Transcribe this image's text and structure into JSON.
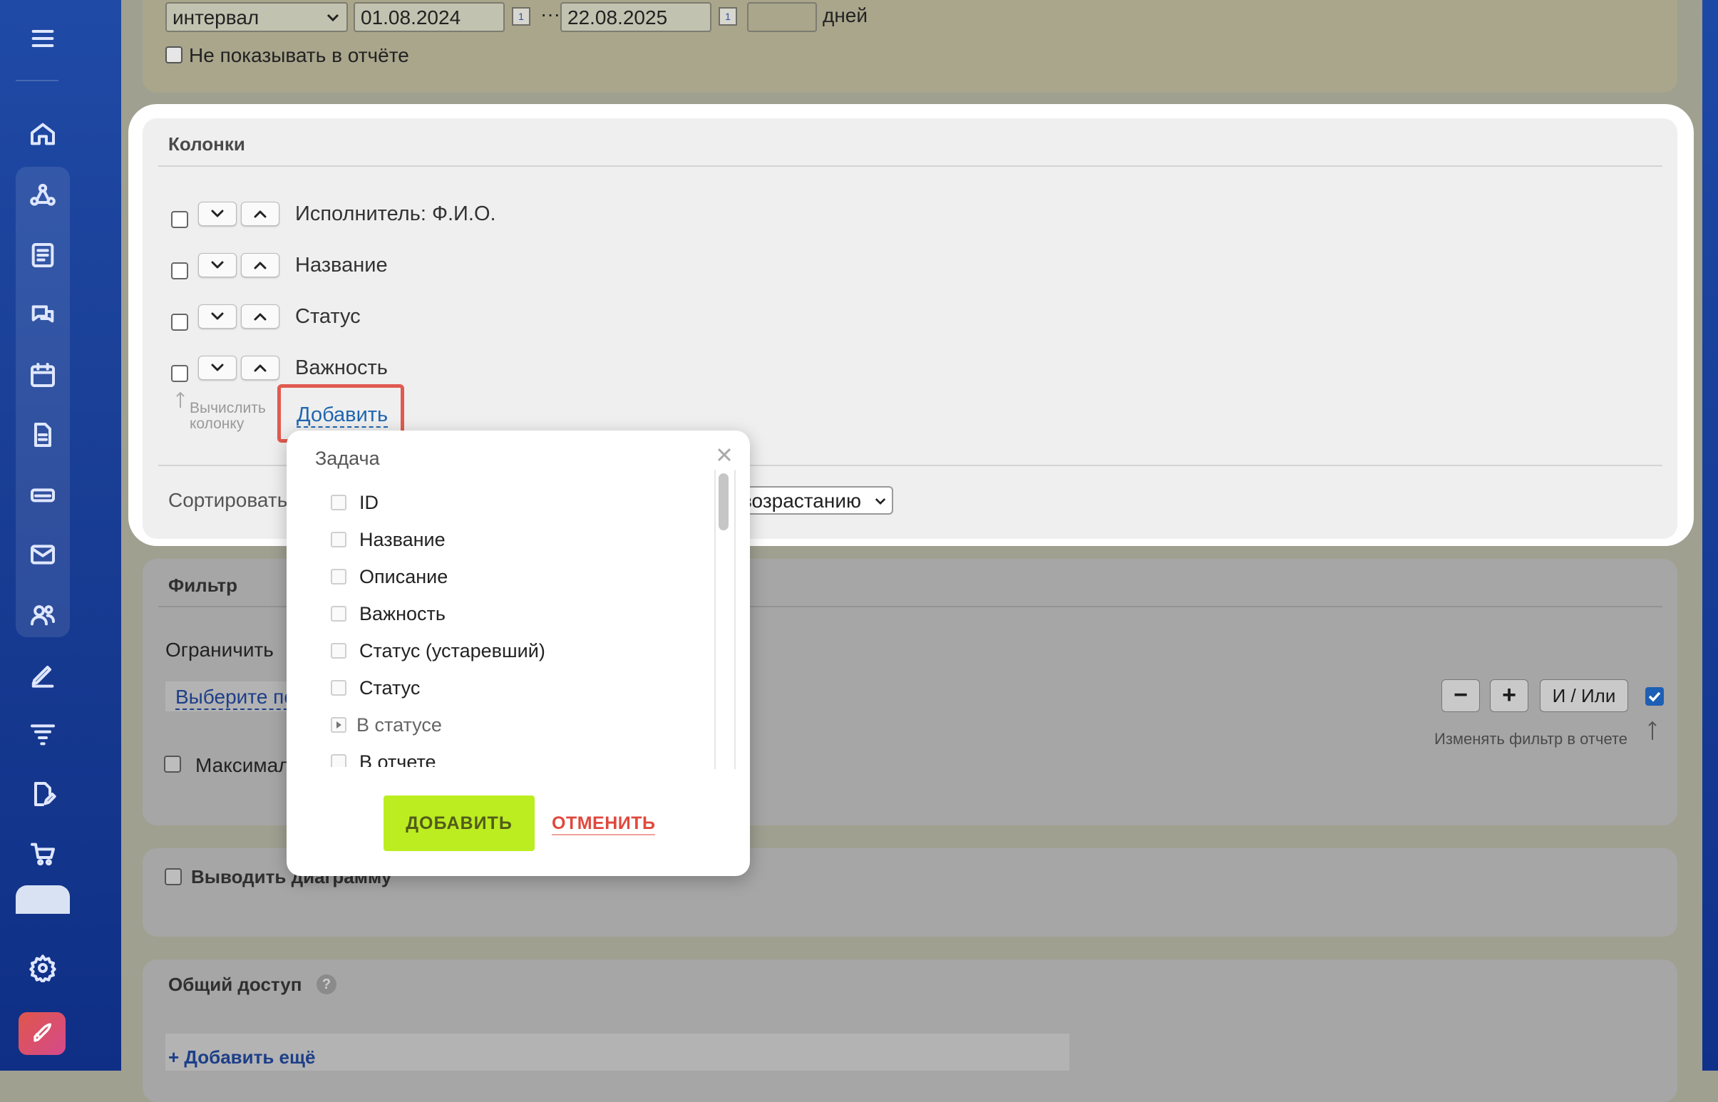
{
  "interval": {
    "period_type": "интервал",
    "date_from": "01.08.2024",
    "separator": "···",
    "date_to": "22.08.2025",
    "days_value": "",
    "days_label": "дней",
    "hide_label": "Не показывать в отчёте"
  },
  "columns": {
    "title": "Колонки",
    "items": [
      {
        "label": "Исполнитель: Ф.И.О."
      },
      {
        "label": "Название"
      },
      {
        "label": "Статус"
      },
      {
        "label": "Важность"
      }
    ],
    "calc_note_line1": "Вычислить",
    "calc_note_line2": "колонку",
    "add_link": "Добавить",
    "sort_label": "Сортировать",
    "sort_order": "возрастанию"
  },
  "filter": {
    "title": "Фильтр",
    "limit_label": "Ограничить",
    "select_link": "Выберите по",
    "max_label": "Максимал",
    "minus": "−",
    "plus": "+",
    "and_or": "И / Или",
    "change_filter_note": "Изменять фильтр в отчете"
  },
  "chart": {
    "label": "Выводить диаграмму"
  },
  "sharing": {
    "title": "Общий доступ",
    "help": "?",
    "add_more": "+ Добавить ещё"
  },
  "popup": {
    "title": "Задача",
    "items": [
      {
        "label": "ID"
      },
      {
        "label": "Название"
      },
      {
        "label": "Описание"
      },
      {
        "label": "Важность"
      },
      {
        "label": "Статус (устаревший)"
      },
      {
        "label": "Статус"
      },
      {
        "label": "В статусе"
      },
      {
        "label": "В отчете"
      }
    ],
    "add_button": "ДОБАВИТЬ",
    "cancel_button": "ОТМЕНИТЬ"
  },
  "colors": {
    "accent_green": "#bbed21",
    "cancel_red": "#e0483d",
    "link_blue": "#2066b0",
    "highlight_red": "#e15a50",
    "sidebar_blue": "#1f4aa6"
  }
}
